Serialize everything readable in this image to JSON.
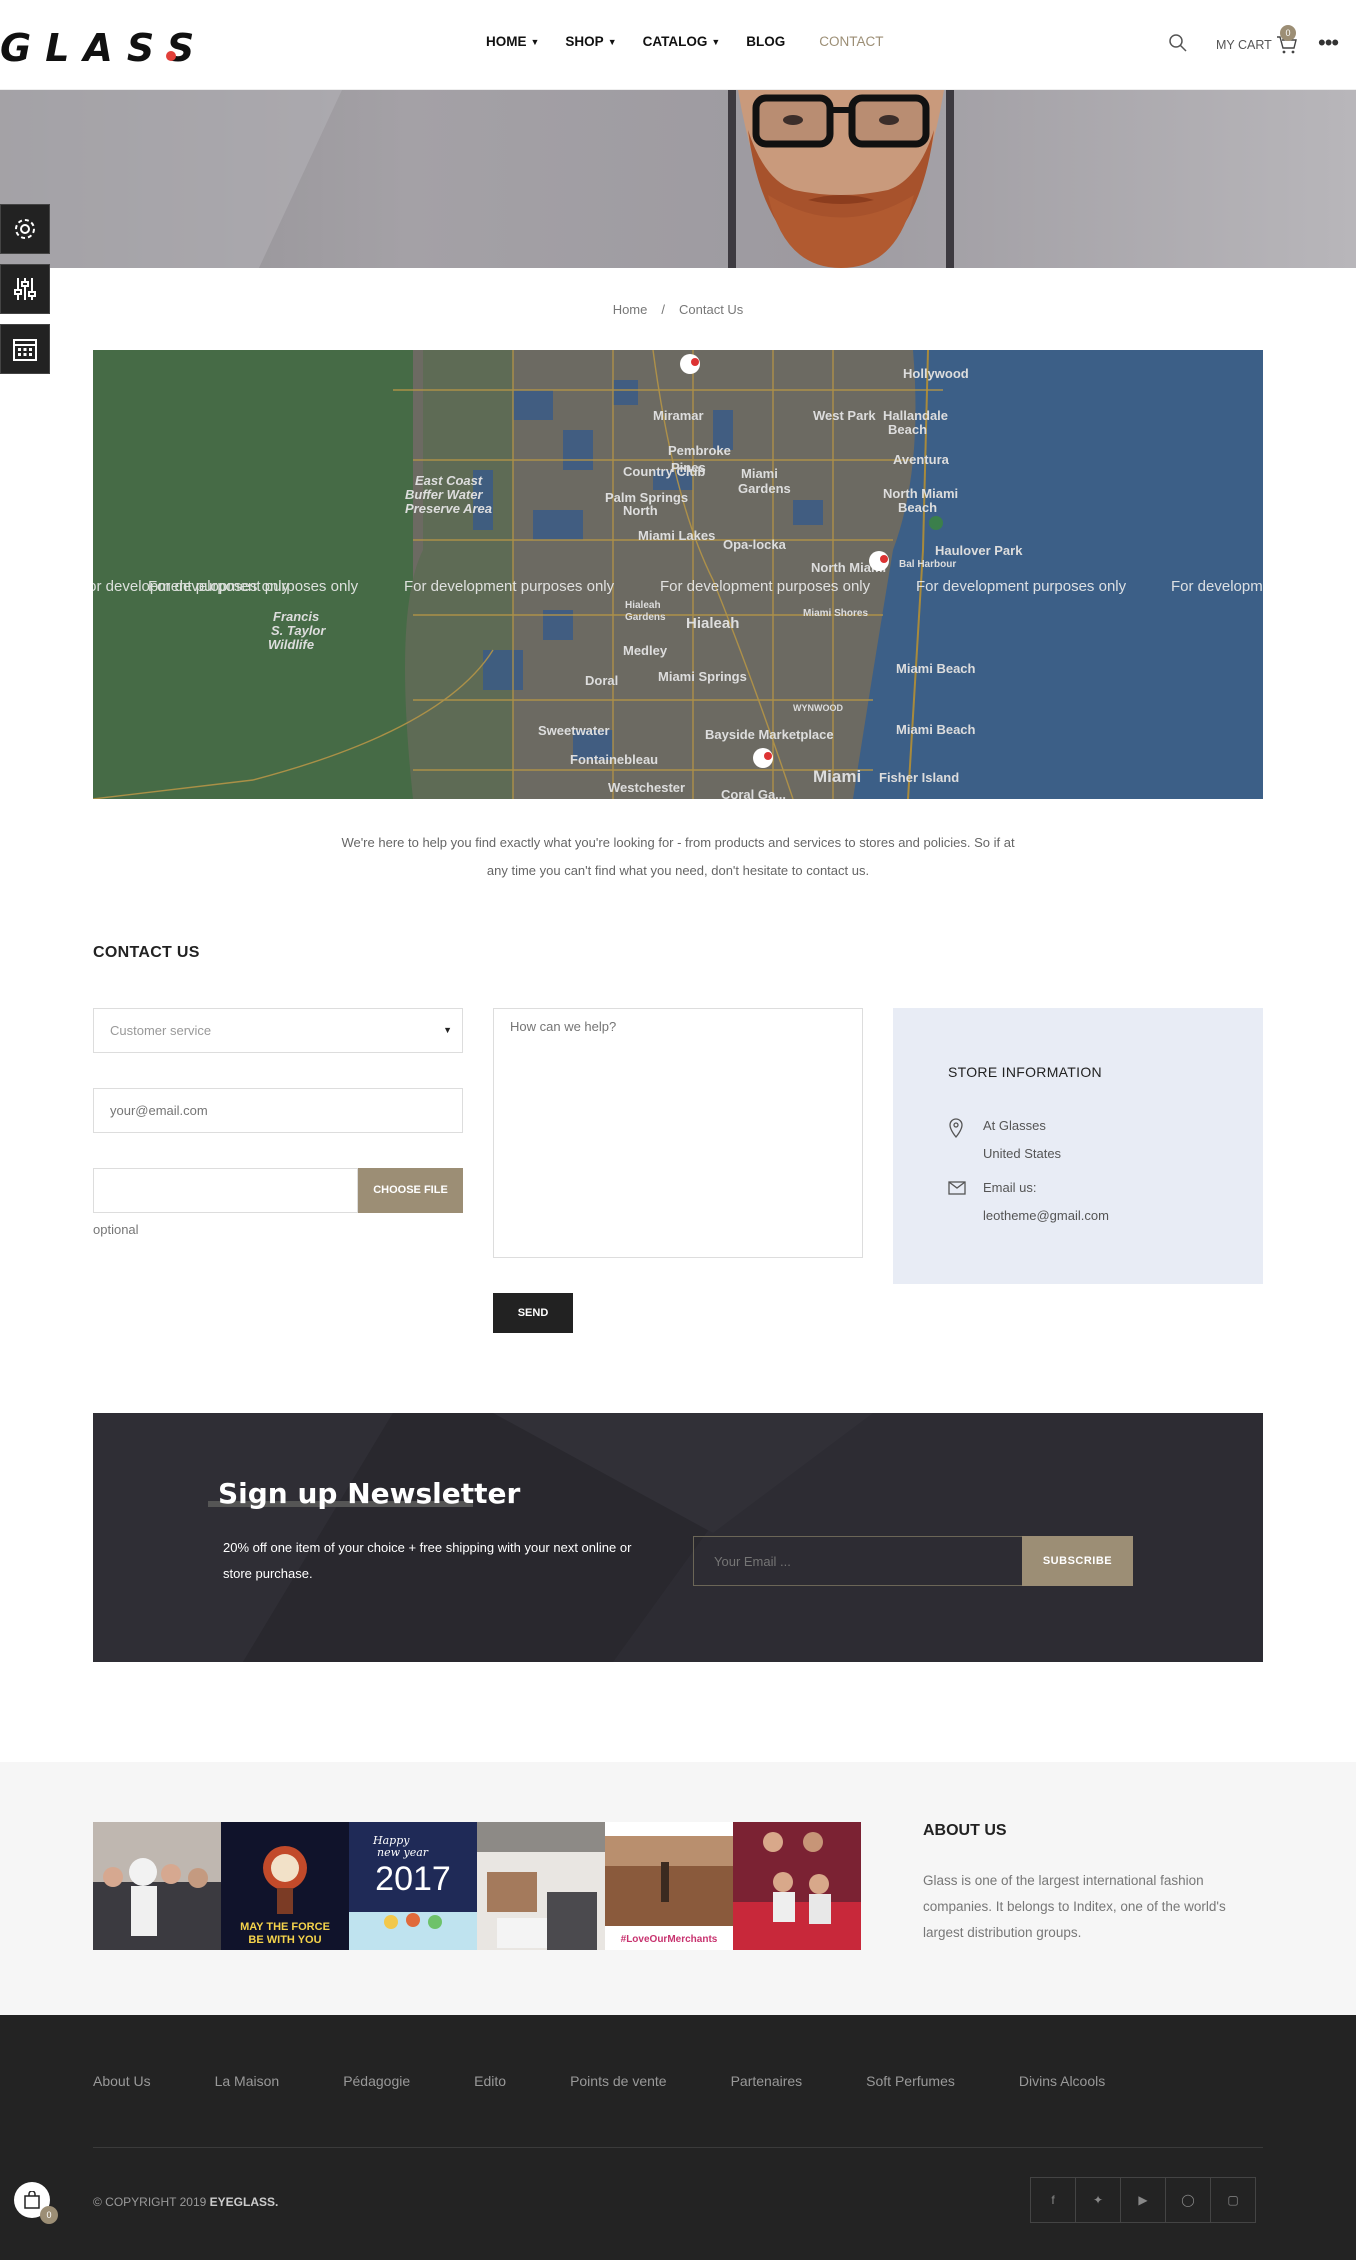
{
  "header": {
    "logo": "GLASS",
    "nav": [
      {
        "label": "HOME",
        "dropdown": true
      },
      {
        "label": "SHOP",
        "dropdown": true
      },
      {
        "label": "CATALOG",
        "dropdown": true
      },
      {
        "label": "BLOG",
        "dropdown": false
      },
      {
        "label": "CONTACT",
        "dropdown": false,
        "active": true
      }
    ],
    "cart_label": "MY CART",
    "cart_count": "0",
    "icons": [
      "search-icon",
      "cart-icon",
      "more-icon"
    ]
  },
  "breadcrumb": {
    "home": "Home",
    "separator": "/",
    "current": "Contact Us"
  },
  "map": {
    "watermark": "For development purposes only",
    "places": [
      "Pembroke Pines",
      "Hollywood",
      "Miramar",
      "West Park",
      "Hallandale Beach",
      "Aventura",
      "Country Club",
      "Miami Gardens",
      "Palm Springs North",
      "North Miami Beach",
      "Opa-locka",
      "Haulover Park",
      "Bal Harbour",
      "North Miami",
      "Miami Lakes",
      "Hialeah Gardens",
      "Hialeah",
      "Miami Shores",
      "Medley",
      "Miami Beach",
      "Doral",
      "Miami Springs",
      "Sweetwater",
      "Bayside Marketplace",
      "Fontainebleau",
      "Miami",
      "Westchester",
      "Fisher Island",
      "Coral Gables",
      "East Coast Buffer Water Preserve Area",
      "Francis S. Taylor Wildlife",
      "WYNWOOD"
    ]
  },
  "intro": "We're here to help you find exactly what you're looking for - from products and services to stores and policies. So if at any time you can't find what you need, don't hesitate to contact us.",
  "contact": {
    "title": "CONTACT US",
    "subject_selected": "Customer service",
    "email_placeholder": "your@email.com",
    "file_button": "CHOOSE FILE",
    "file_note": "optional",
    "message_placeholder": "How can we help?",
    "send": "SEND"
  },
  "store": {
    "title": "STORE INFORMATION",
    "address_line1": "At Glasses",
    "address_line2": "United States",
    "email_label": "Email us:",
    "email": "leotheme@gmail.com"
  },
  "newsletter": {
    "title": "Sign up Newsletter",
    "description": "20% off one item of your choice + free shipping with your next online or store purchase.",
    "placeholder": "Your Email ...",
    "button": "SUBSCRIBE"
  },
  "instagram": {
    "captions": [
      "MAY THE FORCE BE WITH YOU",
      "Happy new year",
      "2017",
      "#LoveOurMerchants"
    ]
  },
  "about": {
    "title": "ABOUT US",
    "text": "Glass is one of the largest international fashion companies. It belongs to Inditex, one of the world's largest distribution groups."
  },
  "footer": {
    "links": [
      "About Us",
      "La Maison",
      "Pédagogie",
      "Edito",
      "Points de vente",
      "Partenaires",
      "Soft Perfumes",
      "Divins Alcools"
    ],
    "copyright_prefix": "© COPYRIGHT 2019 ",
    "copyright_brand": "EYEGLASS.",
    "socials": [
      "facebook-icon",
      "twitter-icon",
      "youtube-icon",
      "pinterest-icon",
      "instagram-icon"
    ],
    "bag_count": "0"
  },
  "colors": {
    "accent": "#9c8e75",
    "logo_dot": "#e2403a",
    "dark": "#222222",
    "store_bg": "#e8ecf5",
    "newsletter_bg": "#2b2a31"
  }
}
